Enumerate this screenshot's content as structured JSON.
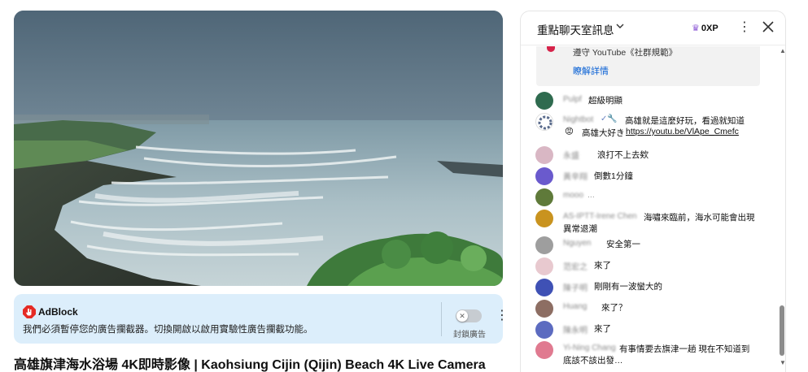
{
  "video": {
    "title": "高雄旗津海水浴場 4K即時影像 | Kaohsiung Cijin (Qijin) Beach 4K Live Camera",
    "scene": "coastal-beach-waves"
  },
  "adblock": {
    "brand": "AdBlock",
    "message": "我們必須暫停您的廣告攔截器。切換開啟以啟用實驗性廣告攔截功能。",
    "toggle_label": "封鎖廣告",
    "toggle_on": false,
    "brand_color": "#e52a24"
  },
  "chat": {
    "header": {
      "title": "重點聊天室訊息",
      "xp_label": "0XP"
    },
    "rules": {
      "text": "遵守 YouTube《社群規範》",
      "link": "瞭解詳情"
    },
    "messages": [
      {
        "author": "Pulpf",
        "text": "超級明顯",
        "avatar_color": "#2f6b4f"
      },
      {
        "author": "Nightbot",
        "author_suffix": "✓🔧",
        "text": "高雄就是這麼好玩，看過就知道",
        "text2_prefix": "高雄大好き",
        "text2_link": "https://youtu.be/VlApe_Cmefc",
        "avatar_color": "#ffffff"
      },
      {
        "author": "永盛",
        "text": "浪打不上去欸",
        "avatar_color": "#d9b7c4"
      },
      {
        "author": "黃辛翔",
        "text": "倒數1分鐘",
        "avatar_color": "#6a5acd"
      },
      {
        "author": "mooo",
        "text": "...",
        "avatar_color": "#5f7a3a"
      },
      {
        "author": "AS-IPTT-Irene Chen",
        "text": "海嘯來臨前，海水可能會出現",
        "text2": "異常退潮",
        "avatar_color": "#c9931f"
      },
      {
        "author": "Nguyen",
        "text": "安全第一",
        "avatar_color": "#9e9e9e"
      },
      {
        "author": "范宏之",
        "text": "來了",
        "avatar_color": "#e8c9cf"
      },
      {
        "author": "陳子明",
        "text": "剛剛有一波蠻大的",
        "avatar_color": "#3f51b5"
      },
      {
        "author": "Huang",
        "text": "來了？",
        "avatar_color": "#8d6e63"
      },
      {
        "author": "陳永明",
        "text": "來了",
        "avatar_color": "#5c6bc0"
      },
      {
        "author": "Yi-Ning Chang",
        "text": "有事情要去旗津一趟 現在不知道到",
        "text2": "底該不該出發…",
        "avatar_color": "#e07a90"
      }
    ]
  }
}
